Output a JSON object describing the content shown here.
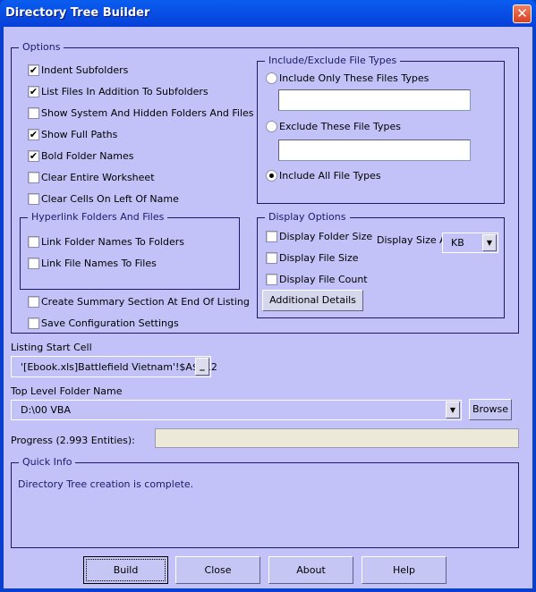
{
  "window": {
    "title": "Directory Tree Builder"
  },
  "options": {
    "legend": "Options",
    "items": [
      {
        "label": "Indent Subfolders",
        "checked": true
      },
      {
        "label": "List Files In Addition To Subfolders",
        "checked": true
      },
      {
        "label": "Show System And Hidden Folders And Files",
        "checked": false
      },
      {
        "label": "Show Full Paths",
        "checked": true
      },
      {
        "label": "Bold Folder Names",
        "checked": true
      },
      {
        "label": "Clear Entire Worksheet",
        "checked": false
      },
      {
        "label": "Clear Cells On Left Of Name",
        "checked": false
      }
    ],
    "hyperlink": {
      "legend": "Hyperlink Folders And Files",
      "items": [
        {
          "label": "Link Folder Names To Folders",
          "checked": false
        },
        {
          "label": "Link File Names To Files",
          "checked": false
        }
      ]
    },
    "summary": {
      "label": "Create Summary Section At End Of Listing",
      "checked": false
    },
    "save": {
      "label": "Save Configuration Settings",
      "checked": false
    }
  },
  "filetypes": {
    "legend": "Include/Exclude File Types",
    "include_only": "Include Only These Files Types",
    "include_only_value": "",
    "exclude": "Exclude These File Types",
    "exclude_value": "",
    "include_all": "Include All File Types",
    "selected": "include_all"
  },
  "display": {
    "legend": "Display Options",
    "items": [
      {
        "label": "Display Folder Size",
        "checked": false
      },
      {
        "label": "Display File Size",
        "checked": false
      },
      {
        "label": "Display File Count",
        "checked": false
      }
    ],
    "size_as_label": "Display Size As",
    "size_as_value": "KB",
    "additional": "Additional Details"
  },
  "listing": {
    "label": "Listing Start Cell",
    "value": "'[Ebook.xls]Battlefield Vietnam'!$A$112",
    "picker": "_"
  },
  "folder": {
    "label": "Top Level Folder Name",
    "value": "D:\\00 VBA",
    "browse": "Browse"
  },
  "progress": {
    "label": "Progress (2.993 Entities):",
    "percent": 0
  },
  "quickinfo": {
    "legend": "Quick Info",
    "text": "Directory Tree creation is complete."
  },
  "buttons": {
    "build": "Build",
    "close": "Close",
    "about": "About",
    "help": "Help"
  },
  "icons": {
    "close": "close-icon",
    "check": "check-icon",
    "dropdown": "chevron-down-icon"
  }
}
